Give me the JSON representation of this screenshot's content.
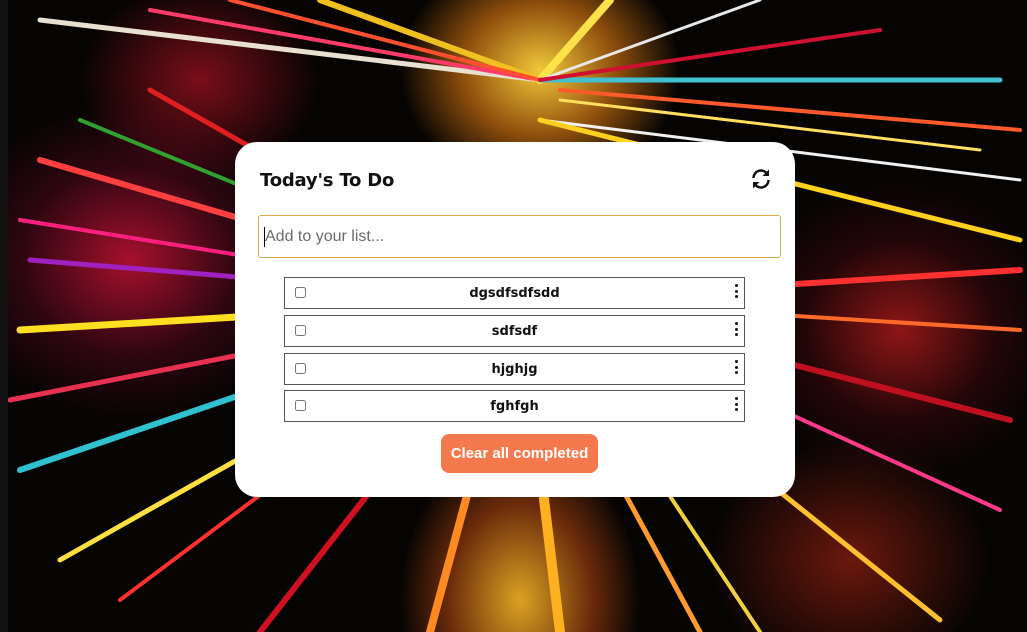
{
  "todo": {
    "title": "Today's To Do",
    "refresh_icon": "refresh-icon",
    "input": {
      "placeholder": "Add to your list...",
      "value": ""
    },
    "items": [
      {
        "label": "dgsdfsdfsdd",
        "checked": false,
        "menu_icon": "more-vertical-icon"
      },
      {
        "label": "sdfsdf",
        "checked": false,
        "menu_icon": "more-vertical-icon"
      },
      {
        "label": "hjghjg",
        "checked": false,
        "menu_icon": "more-vertical-icon"
      },
      {
        "label": "fghfgh",
        "checked": false,
        "menu_icon": "more-vertical-icon"
      }
    ],
    "clear_button_label": "Clear all completed"
  },
  "colors": {
    "input_border": "#e0a64a",
    "clear_button": "#f47a4d",
    "card_background": "#ffffff"
  }
}
